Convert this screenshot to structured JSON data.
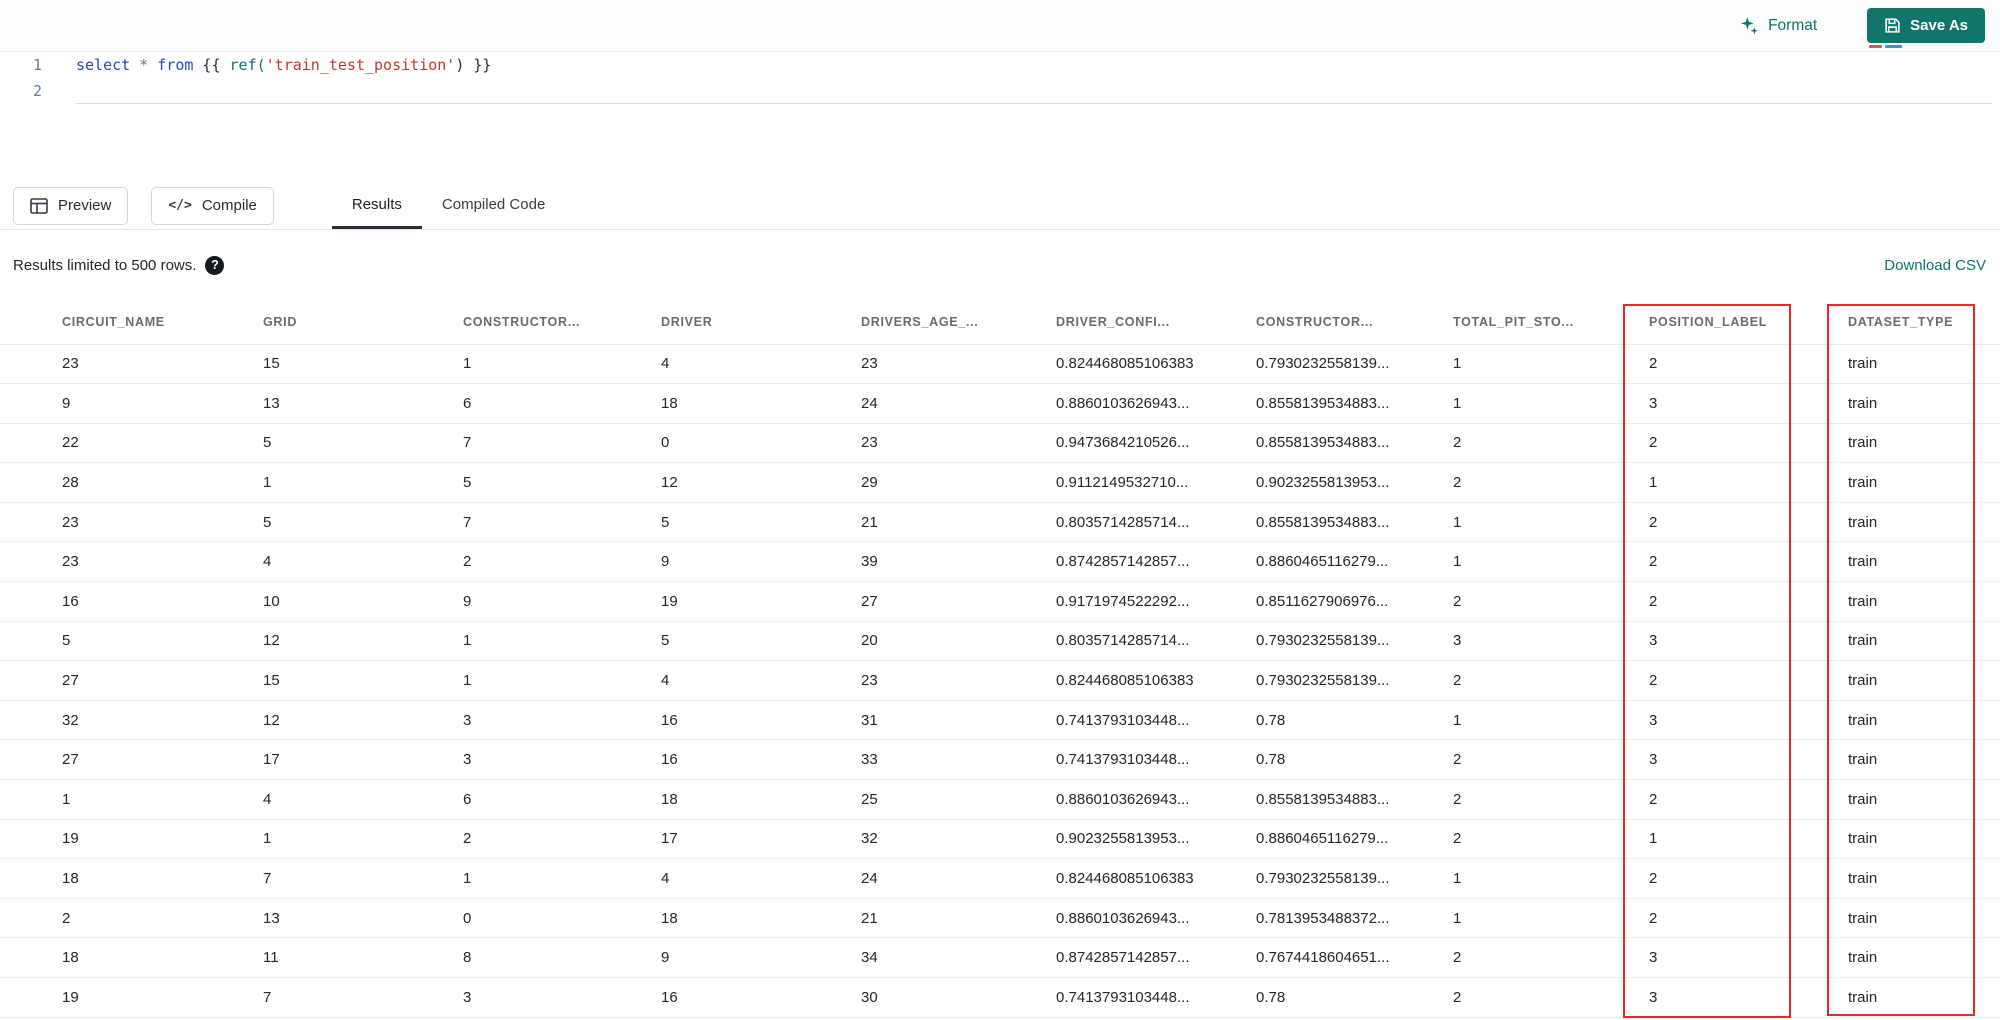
{
  "toolbar": {
    "format_label": "Format",
    "save_as_label": "Save As"
  },
  "editor": {
    "lines": [
      {
        "number": "1",
        "tokens": [
          {
            "text": "select",
            "type": "kw"
          },
          {
            "text": " ",
            "type": "pl"
          },
          {
            "text": "*",
            "type": "op"
          },
          {
            "text": " ",
            "type": "pl"
          },
          {
            "text": "from",
            "type": "kw"
          },
          {
            "text": " {{ ",
            "type": "pl"
          },
          {
            "text": "ref(",
            "type": "fn"
          },
          {
            "text": "'train_test_position'",
            "type": "str"
          },
          {
            "text": ") }}",
            "type": "pl"
          }
        ]
      },
      {
        "number": "2",
        "tokens": []
      }
    ]
  },
  "actions": {
    "preview_label": "Preview",
    "compile_label": "Compile"
  },
  "tabs": [
    {
      "label": "Results",
      "active": true
    },
    {
      "label": "Compiled Code",
      "active": false
    }
  ],
  "results_bar": {
    "limit_text": "Results limited to 500 rows.",
    "help_icon": "question-icon",
    "download_label": "Download CSV"
  },
  "table": {
    "columns": [
      "CIRCUIT_NAME",
      "GRID",
      "CONSTRUCTOR...",
      "DRIVER",
      "DRIVERS_AGE_...",
      "DRIVER_CONFI...",
      "CONSTRUCTOR...",
      "TOTAL_PIT_STO...",
      "POSITION_LABEL",
      "DATASET_TYPE"
    ],
    "rows": [
      [
        "23",
        "15",
        "1",
        "4",
        "23",
        "0.824468085106383",
        "0.7930232558139...",
        "1",
        "2",
        "train"
      ],
      [
        "9",
        "13",
        "6",
        "18",
        "24",
        "0.8860103626943...",
        "0.8558139534883...",
        "1",
        "3",
        "train"
      ],
      [
        "22",
        "5",
        "7",
        "0",
        "23",
        "0.9473684210526...",
        "0.8558139534883...",
        "2",
        "2",
        "train"
      ],
      [
        "28",
        "1",
        "5",
        "12",
        "29",
        "0.9112149532710...",
        "0.9023255813953...",
        "2",
        "1",
        "train"
      ],
      [
        "23",
        "5",
        "7",
        "5",
        "21",
        "0.8035714285714...",
        "0.8558139534883...",
        "1",
        "2",
        "train"
      ],
      [
        "23",
        "4",
        "2",
        "9",
        "39",
        "0.8742857142857...",
        "0.8860465116279...",
        "1",
        "2",
        "train"
      ],
      [
        "16",
        "10",
        "9",
        "19",
        "27",
        "0.9171974522292...",
        "0.8511627906976...",
        "2",
        "2",
        "train"
      ],
      [
        "5",
        "12",
        "1",
        "5",
        "20",
        "0.8035714285714...",
        "0.7930232558139...",
        "3",
        "3",
        "train"
      ],
      [
        "27",
        "15",
        "1",
        "4",
        "23",
        "0.824468085106383",
        "0.7930232558139...",
        "2",
        "2",
        "train"
      ],
      [
        "32",
        "12",
        "3",
        "16",
        "31",
        "0.7413793103448...",
        "0.78",
        "1",
        "3",
        "train"
      ],
      [
        "27",
        "17",
        "3",
        "16",
        "33",
        "0.7413793103448...",
        "0.78",
        "2",
        "3",
        "train"
      ],
      [
        "1",
        "4",
        "6",
        "18",
        "25",
        "0.8860103626943...",
        "0.8558139534883...",
        "2",
        "2",
        "train"
      ],
      [
        "19",
        "1",
        "2",
        "17",
        "32",
        "0.9023255813953...",
        "0.8860465116279...",
        "2",
        "1",
        "train"
      ],
      [
        "18",
        "7",
        "1",
        "4",
        "24",
        "0.824468085106383",
        "0.7930232558139...",
        "1",
        "2",
        "train"
      ],
      [
        "2",
        "13",
        "0",
        "18",
        "21",
        "0.8860103626943...",
        "0.7813953488372...",
        "1",
        "2",
        "train"
      ],
      [
        "18",
        "11",
        "8",
        "9",
        "34",
        "0.8742857142857...",
        "0.7674418604651...",
        "2",
        "3",
        "train"
      ],
      [
        "19",
        "7",
        "3",
        "16",
        "30",
        "0.7413793103448...",
        "0.78",
        "2",
        "3",
        "train"
      ]
    ],
    "highlight": {
      "color": "#e8282d",
      "columns": [
        "POSITION_LABEL",
        "DATASET_TYPE"
      ]
    }
  },
  "icons": {
    "format": "sparkles-icon",
    "save": "save-icon",
    "preview": "table-icon",
    "compile": "code-icon",
    "help": "question-icon"
  },
  "colors": {
    "accent_teal": "#0c756a",
    "save_button_bg": "#10756b",
    "highlight_red": "#e8282d"
  }
}
